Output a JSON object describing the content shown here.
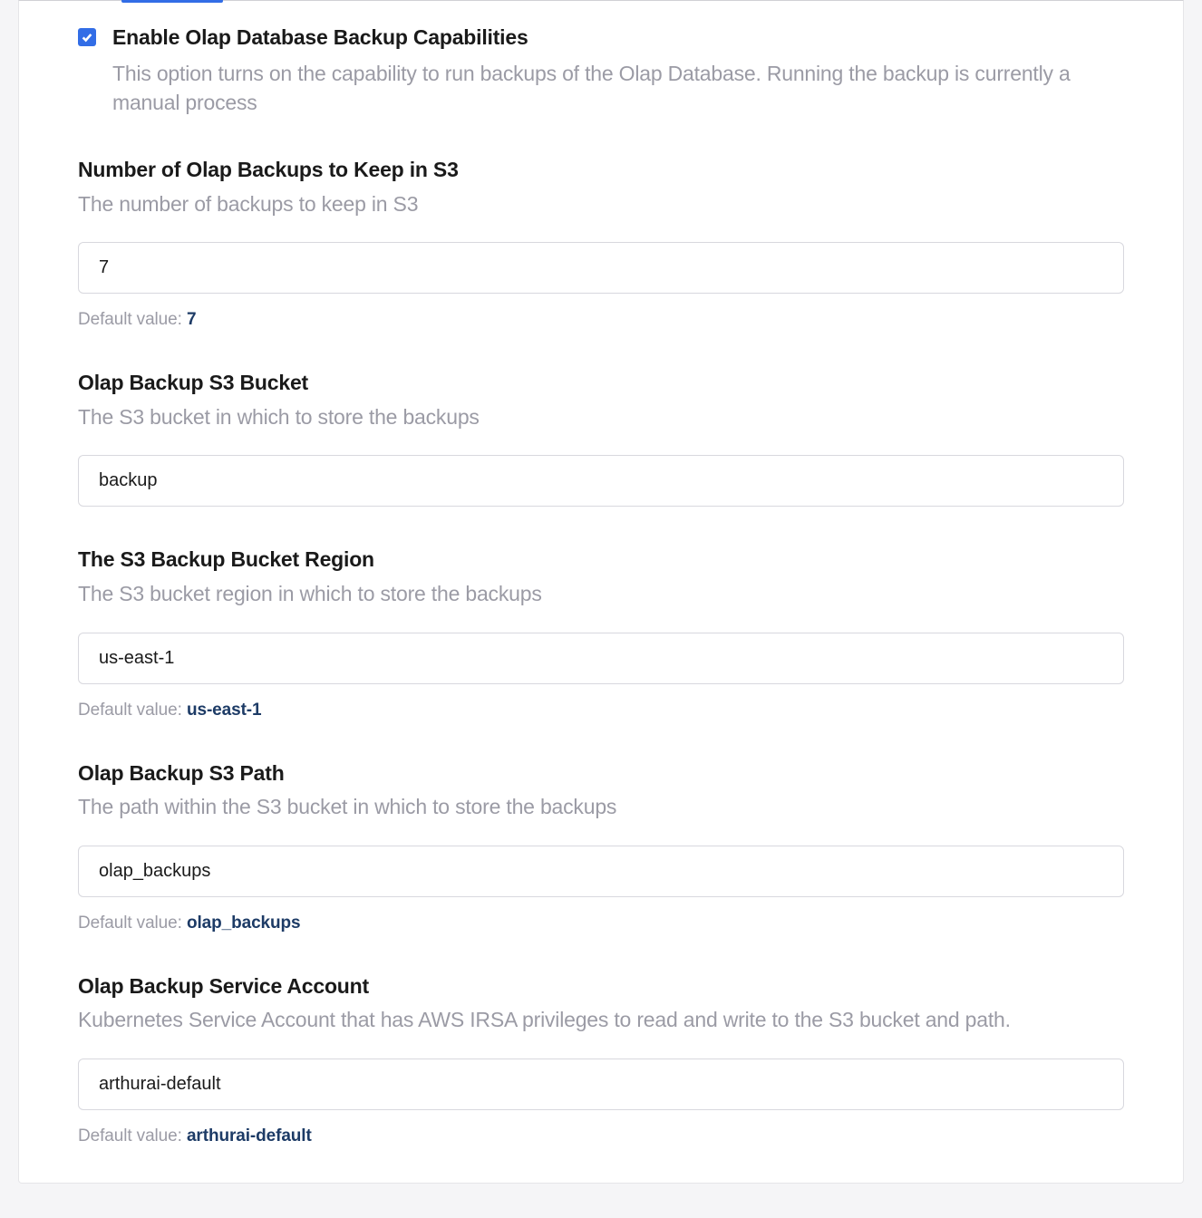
{
  "enable_backup": {
    "label": "Enable Olap Database Backup Capabilities",
    "description": "This option turns on the capability to run backups of the Olap Database. Running the backup is currently a manual process",
    "checked": true
  },
  "num_backups": {
    "title": "Number of Olap Backups to Keep in S3",
    "description": "The number of backups to keep in S3",
    "value": "7",
    "default_label": "Default value: ",
    "default_value": "7"
  },
  "s3_bucket": {
    "title": "Olap Backup S3 Bucket",
    "description": "The S3 bucket in which to store the backups",
    "value": "backup"
  },
  "s3_region": {
    "title": "The S3 Backup Bucket Region",
    "description": "The S3 bucket region in which to store the backups",
    "value": "us-east-1",
    "default_label": "Default value: ",
    "default_value": "us-east-1"
  },
  "s3_path": {
    "title": "Olap Backup S3 Path",
    "description": "The path within the S3 bucket in which to store the backups",
    "value": "olap_backups",
    "default_label": "Default value: ",
    "default_value": "olap_backups"
  },
  "service_account": {
    "title": "Olap Backup Service Account",
    "description": "Kubernetes Service Account that has AWS IRSA privileges to read and write to the S3 bucket and path.",
    "value": "arthurai-default",
    "default_label": "Default value: ",
    "default_value": "arthurai-default"
  }
}
